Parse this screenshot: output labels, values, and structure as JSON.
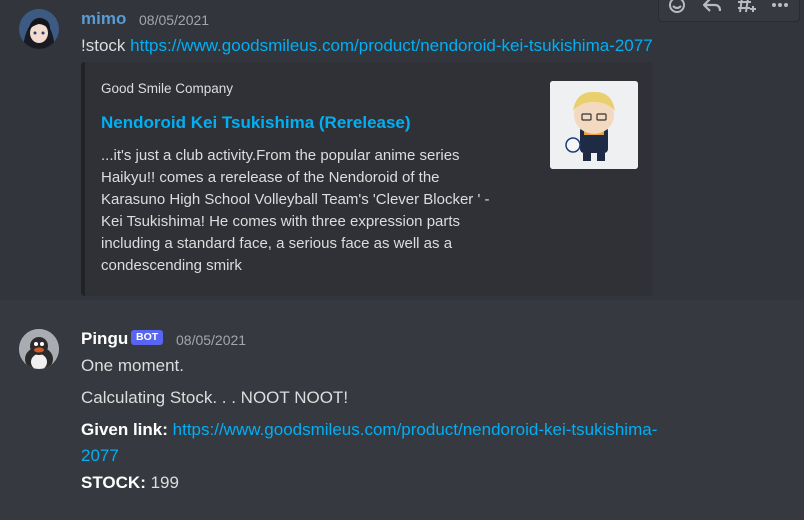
{
  "colors": {
    "link": "#00aff4",
    "bot_tag": "#5865f2",
    "background": "#36393f",
    "embed_bg": "#2f3136"
  },
  "messages": [
    {
      "author": "mimo",
      "author_color": "#5a9bd4",
      "timestamp": "08/05/2021",
      "command": "!stock",
      "link": "https://www.goodsmileus.com/product/nendoroid-kei-tsukishima-2077",
      "embed": {
        "provider": "Good Smile Company",
        "title": "Nendoroid Kei Tsukishima (Rerelease)",
        "description_lines": [
          "...it's just a club activity.From the popular anime series",
          "Haikyu!! comes a rerelease of the Nendoroid of the",
          "Karasuno High School Volleyball Team's 'Clever Blocker ' -",
          "Kei Tsukishima! He comes with three expression parts",
          "including a standard face, a serious face as well as a",
          "condescending smirk"
        ]
      }
    },
    {
      "author": "Pingu",
      "bot_tag": "BOT",
      "timestamp": "08/05/2021",
      "line1": "One moment.",
      "line2": "Calculating Stock. . . NOOT NOOT!",
      "given_link_label": "Given link:",
      "given_link_part1": "https://www.goodsmileus.com/product/nendoroid-kei-tsukishima-",
      "given_link_part2": "2077",
      "stock_label": "STOCK:",
      "stock_value": "199"
    }
  ],
  "toolbar": {
    "icons": [
      "add-reaction-icon",
      "reply-icon",
      "create-thread-icon",
      "more-icon"
    ]
  }
}
